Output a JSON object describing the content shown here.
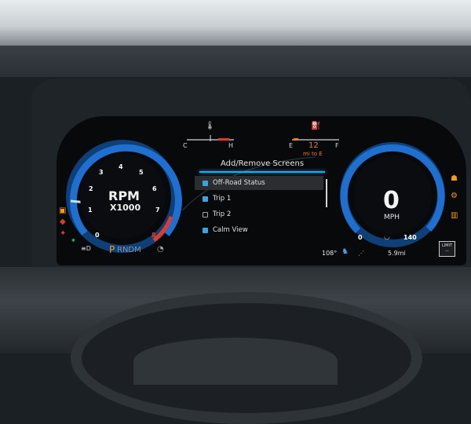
{
  "gauges": {
    "temp": {
      "cold_label": "C",
      "hot_label": "H"
    },
    "fuel": {
      "empty_label": "E",
      "full_label": "F",
      "range_value": "12",
      "range_unit": "mi to E"
    }
  },
  "tachometer": {
    "label": "RPM",
    "multiplier": "X1000",
    "ticks": [
      "0",
      "1",
      "2",
      "3",
      "4",
      "5",
      "6",
      "7",
      "8"
    ]
  },
  "menu": {
    "title": "Add/Remove Screens",
    "items": [
      {
        "label": "Off-Road Status",
        "checked": true,
        "selected": true
      },
      {
        "label": "Trip 1",
        "checked": true,
        "selected": false
      },
      {
        "label": "Trip 2",
        "checked": false,
        "selected": false
      },
      {
        "label": "Calm View",
        "checked": true,
        "selected": false
      }
    ]
  },
  "speedometer": {
    "value": "0",
    "unit": "MPH",
    "min_label": "0",
    "max_label": "140"
  },
  "gear": {
    "active": "P",
    "rest": "RNDM"
  },
  "status": {
    "outside_temp": "108°",
    "trip_distance": "5.9mi",
    "limit_label": "LIMIT",
    "limit_value": "--"
  },
  "colors": {
    "accent_blue": "#2aa7e8",
    "redline": "#e23a2a",
    "amber": "#f39a1d",
    "fuel_orange": "#f07a1a"
  },
  "icons": [
    "coolant-temp-icon",
    "fuel-pump-icon",
    "seatbelt-icon",
    "door-open-icon",
    "oil-icon",
    "headlight-icon",
    "battery-icon",
    "tire-pressure-icon",
    "engine-icon",
    "mode-icon"
  ]
}
